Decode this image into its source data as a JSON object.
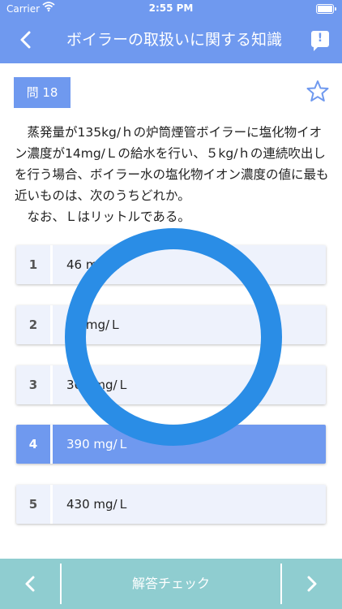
{
  "status": {
    "carrier": "Carrier",
    "time": "2:55 PM"
  },
  "nav": {
    "title": "ボイラーの取扱いに関する知識",
    "report_icon_glyph": "!"
  },
  "question": {
    "badge": "問 18",
    "paragraphs": [
      "蒸発量が135kg/ｈの炉筒煙管ボイラーに塩化物イオン濃度が14mg/Ｌの給水を行い、５kg/ｈの連続吹出しを行う場合、ボイラー水の塩化物イオン濃度の値に最も近いものは、次のうちどれか。",
      "なお、Ｌはリットルである。"
    ]
  },
  "choices": [
    {
      "num": "1",
      "text": "46 mg/Ｌ"
    },
    {
      "num": "2",
      "text": "70 mg/Ｌ"
    },
    {
      "num": "3",
      "text": "360 mg/Ｌ"
    },
    {
      "num": "4",
      "text": "390 mg/Ｌ",
      "selected": true
    },
    {
      "num": "5",
      "text": "430 mg/Ｌ"
    }
  ],
  "overlay": {
    "type": "correct-ring",
    "color": "#2a8de6"
  },
  "bottom": {
    "check_label": "解答チェック"
  },
  "colors": {
    "accent": "#6f99ef",
    "bottom_bar": "#8fcdd0",
    "choice_bg": "#eef2fc"
  }
}
